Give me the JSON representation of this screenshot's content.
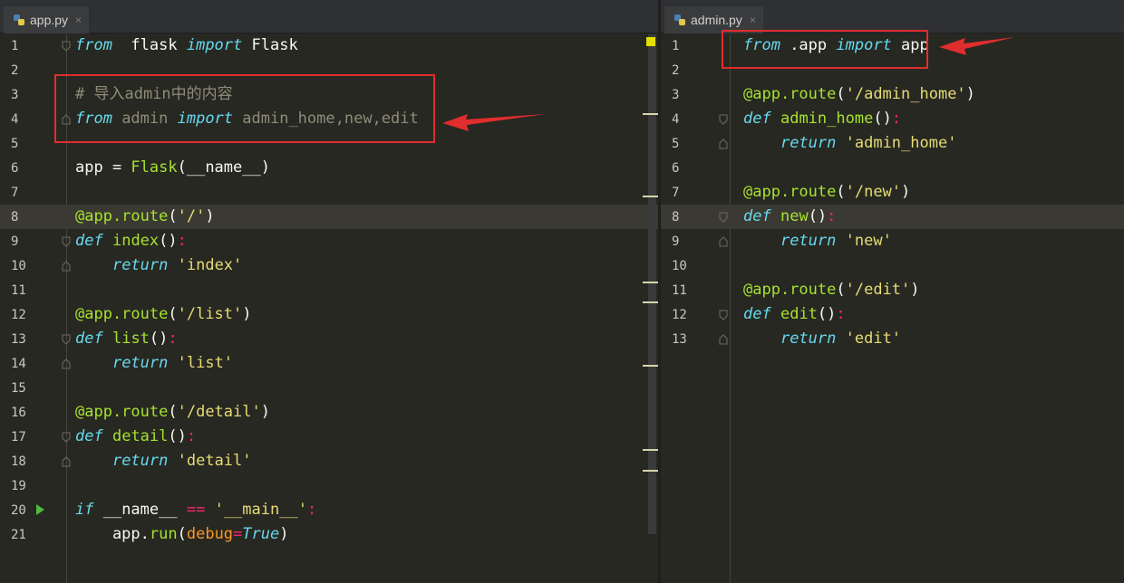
{
  "left_editor": {
    "tab": {
      "label": "app.py",
      "close": "×"
    },
    "lines": [
      {
        "n": "1",
        "tokens": [
          [
            "kw",
            "from"
          ],
          [
            "",
            "  flask "
          ],
          [
            "kw",
            "import"
          ],
          [
            "",
            " Flask"
          ]
        ]
      },
      {
        "n": "2",
        "tokens": []
      },
      {
        "n": "3",
        "tokens": [
          [
            "cmt",
            "# 导入admin中的内容"
          ]
        ]
      },
      {
        "n": "4",
        "tokens": [
          [
            "kw",
            "from"
          ],
          [
            "cmt",
            " admin "
          ],
          [
            "kw",
            "import"
          ],
          [
            "cmt",
            " admin_home,new,edit"
          ]
        ]
      },
      {
        "n": "5",
        "tokens": []
      },
      {
        "n": "6",
        "tokens": [
          [
            "",
            "app = "
          ],
          [
            "fn",
            "Flask"
          ],
          [
            "",
            "(__name__)"
          ]
        ]
      },
      {
        "n": "7",
        "tokens": []
      },
      {
        "n": "8",
        "tokens": [
          [
            "dec",
            "@app.route"
          ],
          [
            "",
            "("
          ],
          [
            "str",
            "'/'"
          ],
          [
            "",
            ")"
          ]
        ]
      },
      {
        "n": "9",
        "tokens": [
          [
            "kw",
            "def"
          ],
          [
            "",
            " "
          ],
          [
            "fn",
            "index"
          ],
          [
            "",
            "()"
          ],
          [
            "op",
            ":"
          ]
        ]
      },
      {
        "n": "10",
        "tokens": [
          [
            "",
            "    "
          ],
          [
            "kw",
            "return"
          ],
          [
            "",
            " "
          ],
          [
            "str",
            "'index'"
          ]
        ]
      },
      {
        "n": "11",
        "tokens": []
      },
      {
        "n": "12",
        "tokens": [
          [
            "dec",
            "@app.route"
          ],
          [
            "",
            "("
          ],
          [
            "str",
            "'/list'"
          ],
          [
            "",
            ")"
          ]
        ]
      },
      {
        "n": "13",
        "tokens": [
          [
            "kw",
            "def"
          ],
          [
            "",
            " "
          ],
          [
            "fn",
            "list"
          ],
          [
            "",
            "()"
          ],
          [
            "op",
            ":"
          ]
        ]
      },
      {
        "n": "14",
        "tokens": [
          [
            "",
            "    "
          ],
          [
            "kw",
            "return"
          ],
          [
            "",
            " "
          ],
          [
            "str",
            "'list'"
          ]
        ]
      },
      {
        "n": "15",
        "tokens": []
      },
      {
        "n": "16",
        "tokens": [
          [
            "dec",
            "@app.route"
          ],
          [
            "",
            "("
          ],
          [
            "str",
            "'/detail'"
          ],
          [
            "",
            ")"
          ]
        ]
      },
      {
        "n": "17",
        "tokens": [
          [
            "kw",
            "def"
          ],
          [
            "",
            " "
          ],
          [
            "fn",
            "detail"
          ],
          [
            "",
            "()"
          ],
          [
            "op",
            ":"
          ]
        ]
      },
      {
        "n": "18",
        "tokens": [
          [
            "",
            "    "
          ],
          [
            "kw",
            "return"
          ],
          [
            "",
            " "
          ],
          [
            "str",
            "'detail'"
          ]
        ]
      },
      {
        "n": "19",
        "tokens": []
      },
      {
        "n": "20",
        "tokens": [
          [
            "kw",
            "if"
          ],
          [
            "",
            " __name__ "
          ],
          [
            "op",
            "=="
          ],
          [
            "",
            " "
          ],
          [
            "str",
            "'__main__'"
          ],
          [
            "op",
            ":"
          ]
        ]
      },
      {
        "n": "21",
        "tokens": [
          [
            "",
            "    app."
          ],
          [
            "fn",
            "run"
          ],
          [
            "",
            "("
          ],
          [
            "prm",
            "debug"
          ],
          [
            "op",
            "="
          ],
          [
            "builtin",
            "True"
          ],
          [
            "",
            ")"
          ]
        ]
      }
    ]
  },
  "right_editor": {
    "tab": {
      "label": "admin.py",
      "close": "×"
    },
    "lines": [
      {
        "n": "1",
        "tokens": [
          [
            "kw",
            "from"
          ],
          [
            "",
            " .app "
          ],
          [
            "kw",
            "import"
          ],
          [
            "",
            " app"
          ]
        ]
      },
      {
        "n": "2",
        "tokens": []
      },
      {
        "n": "3",
        "tokens": [
          [
            "dec",
            "@app.route"
          ],
          [
            "",
            "("
          ],
          [
            "str",
            "'/admin_home'"
          ],
          [
            "",
            ")"
          ]
        ]
      },
      {
        "n": "4",
        "tokens": [
          [
            "kw",
            "def"
          ],
          [
            "",
            " "
          ],
          [
            "fn",
            "admin_home"
          ],
          [
            "",
            "()"
          ],
          [
            "op",
            ":"
          ]
        ]
      },
      {
        "n": "5",
        "tokens": [
          [
            "",
            "    "
          ],
          [
            "kw",
            "return"
          ],
          [
            "",
            " "
          ],
          [
            "str",
            "'admin_home'"
          ]
        ]
      },
      {
        "n": "6",
        "tokens": []
      },
      {
        "n": "7",
        "tokens": [
          [
            "dec",
            "@app.route"
          ],
          [
            "",
            "("
          ],
          [
            "str",
            "'/new'"
          ],
          [
            "",
            ")"
          ]
        ]
      },
      {
        "n": "8",
        "tokens": [
          [
            "kw",
            "def"
          ],
          [
            "",
            " "
          ],
          [
            "fn",
            "new"
          ],
          [
            "",
            "()"
          ],
          [
            "op",
            ":"
          ]
        ]
      },
      {
        "n": "9",
        "tokens": [
          [
            "",
            "    "
          ],
          [
            "kw",
            "return"
          ],
          [
            "",
            " "
          ],
          [
            "str",
            "'new'"
          ]
        ]
      },
      {
        "n": "10",
        "tokens": []
      },
      {
        "n": "11",
        "tokens": [
          [
            "dec",
            "@app.route"
          ],
          [
            "",
            "("
          ],
          [
            "str",
            "'/edit'"
          ],
          [
            "",
            ")"
          ]
        ]
      },
      {
        "n": "12",
        "tokens": [
          [
            "kw",
            "def"
          ],
          [
            "",
            " "
          ],
          [
            "fn",
            "edit"
          ],
          [
            "",
            "()"
          ],
          [
            "op",
            ":"
          ]
        ]
      },
      {
        "n": "13",
        "tokens": [
          [
            "",
            "    "
          ],
          [
            "kw",
            "return"
          ],
          [
            "",
            " "
          ],
          [
            "str",
            "'edit'"
          ]
        ]
      }
    ]
  },
  "colors": {
    "keyword": "#66d9ef",
    "string": "#e6db74",
    "comment": "#8f8c79",
    "function": "#a6e22e",
    "operator": "#f92672",
    "annotation": "#e02d2d"
  },
  "icons": {
    "tab_file": "python-file-icon",
    "run": "run-arrow-icon",
    "fold": "fold-marker-icon"
  }
}
